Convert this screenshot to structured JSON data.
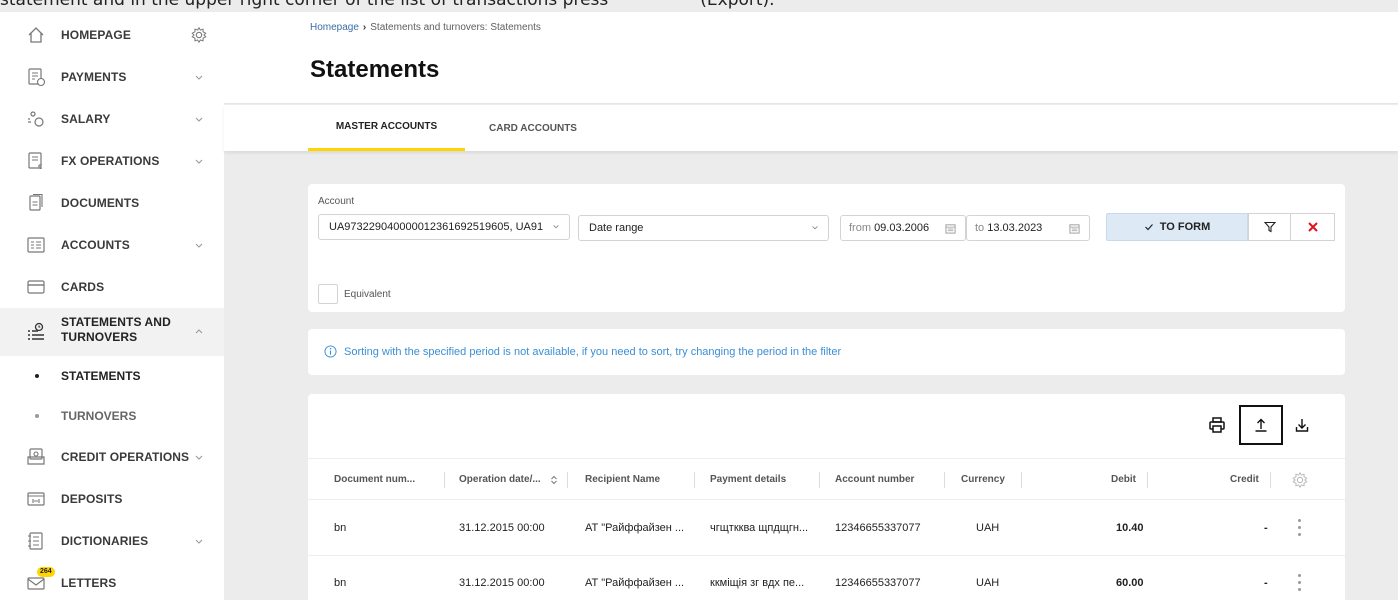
{
  "instruction": {
    "text_before": "statement and in the upper right corner of the list of transactions press",
    "text_after": "(Export)."
  },
  "sidebar": {
    "items": [
      {
        "label": "HOMEPAGE",
        "icon": "home-icon"
      },
      {
        "label": "PAYMENTS",
        "icon": "payments-icon"
      },
      {
        "label": "SALARY",
        "icon": "salary-icon"
      },
      {
        "label": "FX OPERATIONS",
        "icon": "fx-operations-icon"
      },
      {
        "label": "DOCUMENTS",
        "icon": "documents-icon"
      },
      {
        "label": "ACCOUNTS",
        "icon": "accounts-icon"
      },
      {
        "label": "CARDS",
        "icon": "card-icon"
      },
      {
        "label_line1": "STATEMENTS AND",
        "label_line2": "TURNOVERS",
        "icon": "statements-icon"
      },
      {
        "label": "STATEMENTS"
      },
      {
        "label": "TURNOVERS"
      },
      {
        "label": "CREDIT OPERATIONS",
        "icon": "credit-icon"
      },
      {
        "label": "DEPOSITS",
        "icon": "deposits-icon"
      },
      {
        "label": "DICTIONARIES",
        "icon": "dictionaries-icon"
      },
      {
        "label": "LETTERS",
        "icon": "mail-icon",
        "badge": "264"
      }
    ]
  },
  "header": {
    "breadcrumb": {
      "home": "Homepage",
      "current": "Statements and turnovers: Statements"
    },
    "title": "Statements"
  },
  "tabs": [
    {
      "label": "MASTER ACCOUNTS",
      "active": true
    },
    {
      "label": "CARD ACCOUNTS",
      "active": false
    }
  ],
  "filter": {
    "account_label": "Account",
    "account_value": "UA973229040000012361692519605, UA91",
    "range_value": "Date range",
    "from_prefix": "from",
    "from_value": "09.03.2006",
    "to_prefix": "to",
    "to_value": "13.03.2023",
    "form_button": "TO FORM",
    "equivalent_label": "Equivalent"
  },
  "info_message": "Sorting with the specified period is not available, if you need to sort, try changing the period in the filter",
  "table": {
    "columns": [
      "Document num...",
      "Operation date/...",
      "Recipient Name",
      "Payment details",
      "Account number",
      "Currency",
      "Debit",
      "Credit"
    ],
    "rows": [
      {
        "doc": "bn",
        "date": "31.12.2015 00:00",
        "recipient": "АТ \"Райффайзен ...",
        "details": "чгщткква щпдщгн...",
        "account": "12346655337077",
        "currency": "UAH",
        "debit": "10.40",
        "credit": "-"
      },
      {
        "doc": "bn",
        "date": "31.12.2015 00:00",
        "recipient": "АТ \"Райффайзен ...",
        "details": "ккміщія зг вдх пе...",
        "account": "12346655337077",
        "currency": "UAH",
        "debit": "60.00",
        "credit": "-"
      }
    ]
  },
  "colors": {
    "accent": "#ffd400",
    "link": "#3a6ea5",
    "info": "#3a8fd6",
    "danger": "#e0141e"
  }
}
